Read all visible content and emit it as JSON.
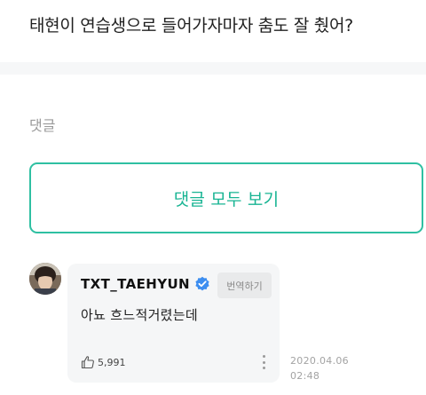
{
  "post": {
    "question": "태현이 연습생으로 들어가자마자 춤도 잘 췄어?"
  },
  "comments": {
    "heading": "댓글",
    "view_all_label": "댓글 모두 보기"
  },
  "comment": {
    "author": "TXT_TAEHYUN",
    "verified_icon": "verified-badge-icon",
    "translate_label": "번역하기",
    "text": "아뇨 흐느적거렸는데",
    "like_icon": "thumbs-up-icon",
    "likes": "5,991",
    "date": "2020.04.06",
    "time": "02:48"
  },
  "colors": {
    "accent": "#2fc0a2",
    "accent_text": "#18b493",
    "verified": "#3d8ef0",
    "bubble_bg": "#f5f6f7"
  }
}
